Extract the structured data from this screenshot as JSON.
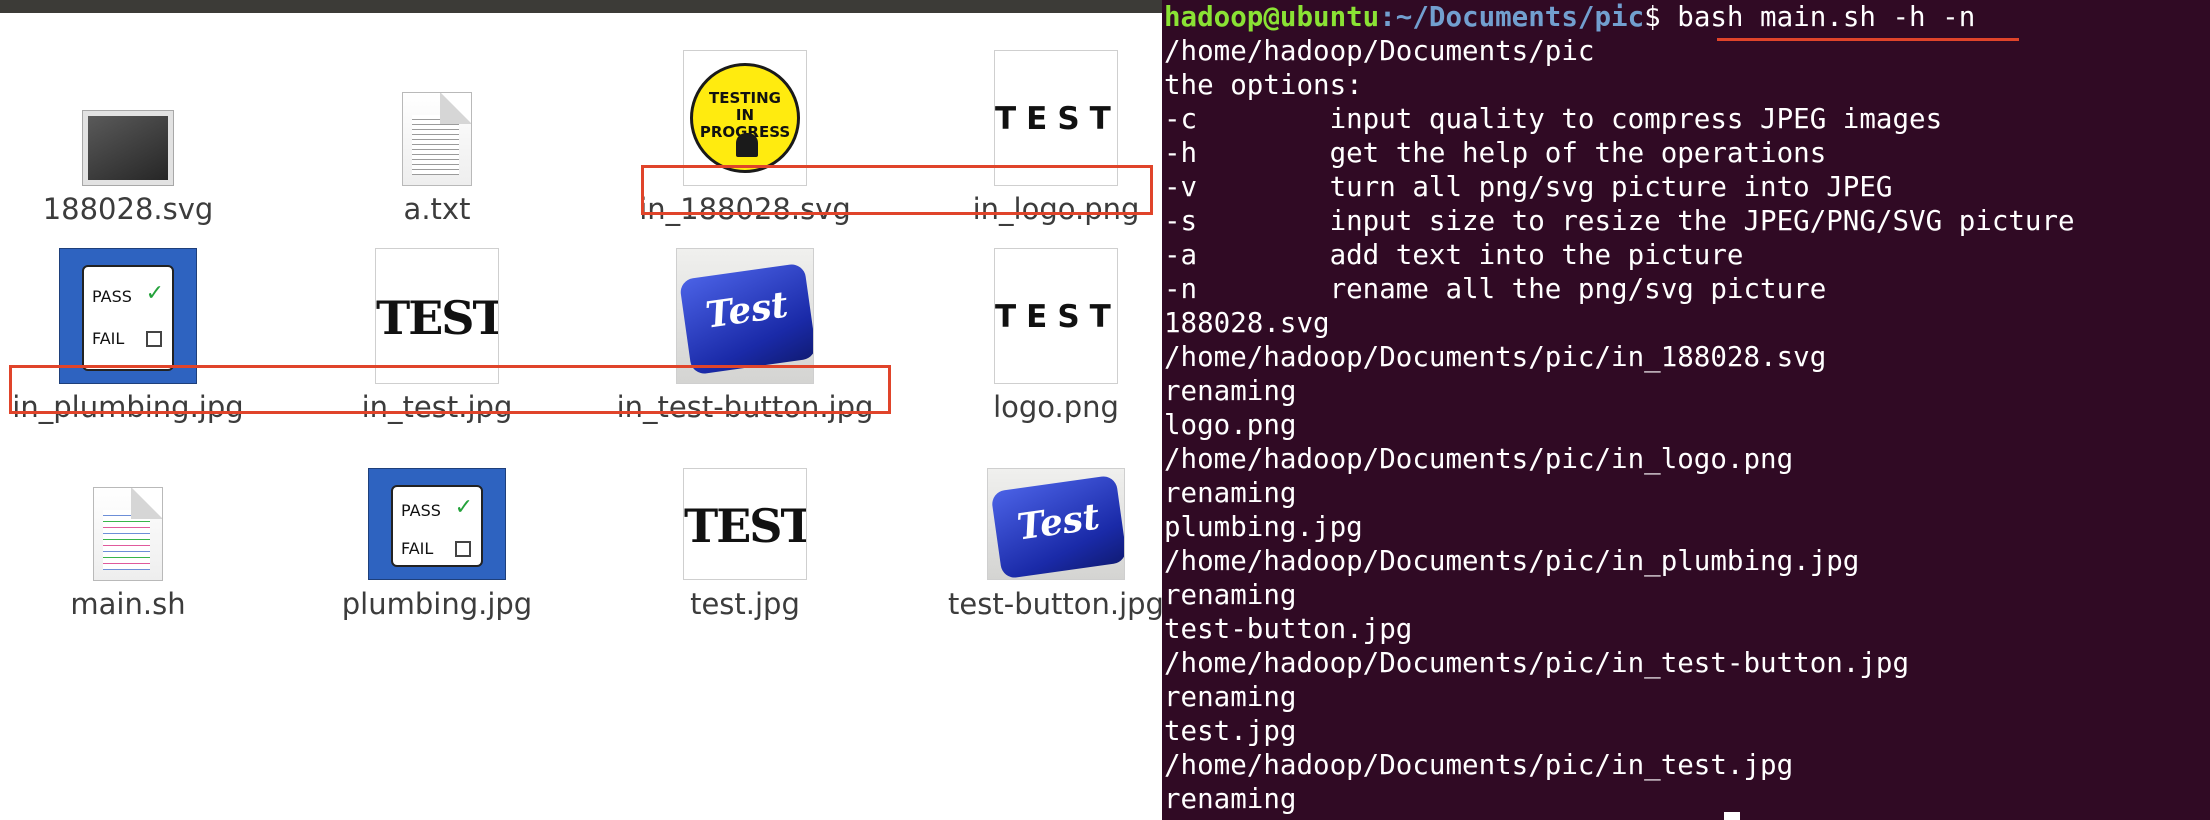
{
  "file_manager": {
    "files": [
      {
        "name": "188028.svg"
      },
      {
        "name": "a.txt"
      },
      {
        "name": "in_188028.svg",
        "badge_lines": [
          "TESTING",
          "IN",
          "PROGRESS"
        ]
      },
      {
        "name": "in_logo.png",
        "logo_text": "TEST"
      },
      {
        "name": "in_plumbing.jpg",
        "pass_label": "PASS",
        "fail_label": "FAIL"
      },
      {
        "name": "in_test.jpg",
        "image_text": "TEST"
      },
      {
        "name": "in_test-button.jpg",
        "key_text": "Test"
      },
      {
        "name": "logo.png",
        "logo_text": "TEST"
      },
      {
        "name": "main.sh"
      },
      {
        "name": "plumbing.jpg",
        "pass_label": "PASS",
        "fail_label": "FAIL"
      },
      {
        "name": "test.jpg",
        "image_text": "TEST"
      },
      {
        "name": "test-button.jpg",
        "key_text": "Test"
      }
    ],
    "annotation_color": "#e0442a"
  },
  "terminal": {
    "prompt_user": "hadoop@ubuntu",
    "prompt_path": ":~/Documents/pic",
    "prompt_symbol": "$ ",
    "command": "bash main.sh -h -n",
    "lines": [
      "/home/hadoop/Documents/pic",
      "the options:",
      "-c        input quality to compress JPEG images",
      "-h        get the help of the operations",
      "-v        turn all png/svg picture into JPEG",
      "-s        input size to resize the JPEG/PNG/SVG picture",
      "-a        add text into the picture",
      "-n        rename all the png/svg picture",
      "188028.svg",
      "/home/hadoop/Documents/pic/in_188028.svg",
      "renaming",
      "logo.png",
      "/home/hadoop/Documents/pic/in_logo.png",
      "renaming",
      "plumbing.jpg",
      "/home/hadoop/Documents/pic/in_plumbing.jpg",
      "renaming",
      "test-button.jpg",
      "/home/hadoop/Documents/pic/in_test-button.jpg",
      "renaming",
      "test.jpg",
      "/home/hadoop/Documents/pic/in_test.jpg",
      "renaming"
    ],
    "colors": {
      "background": "#300a24",
      "user": "#8ae234",
      "path": "#729fcf",
      "text": "#ffffff"
    }
  }
}
